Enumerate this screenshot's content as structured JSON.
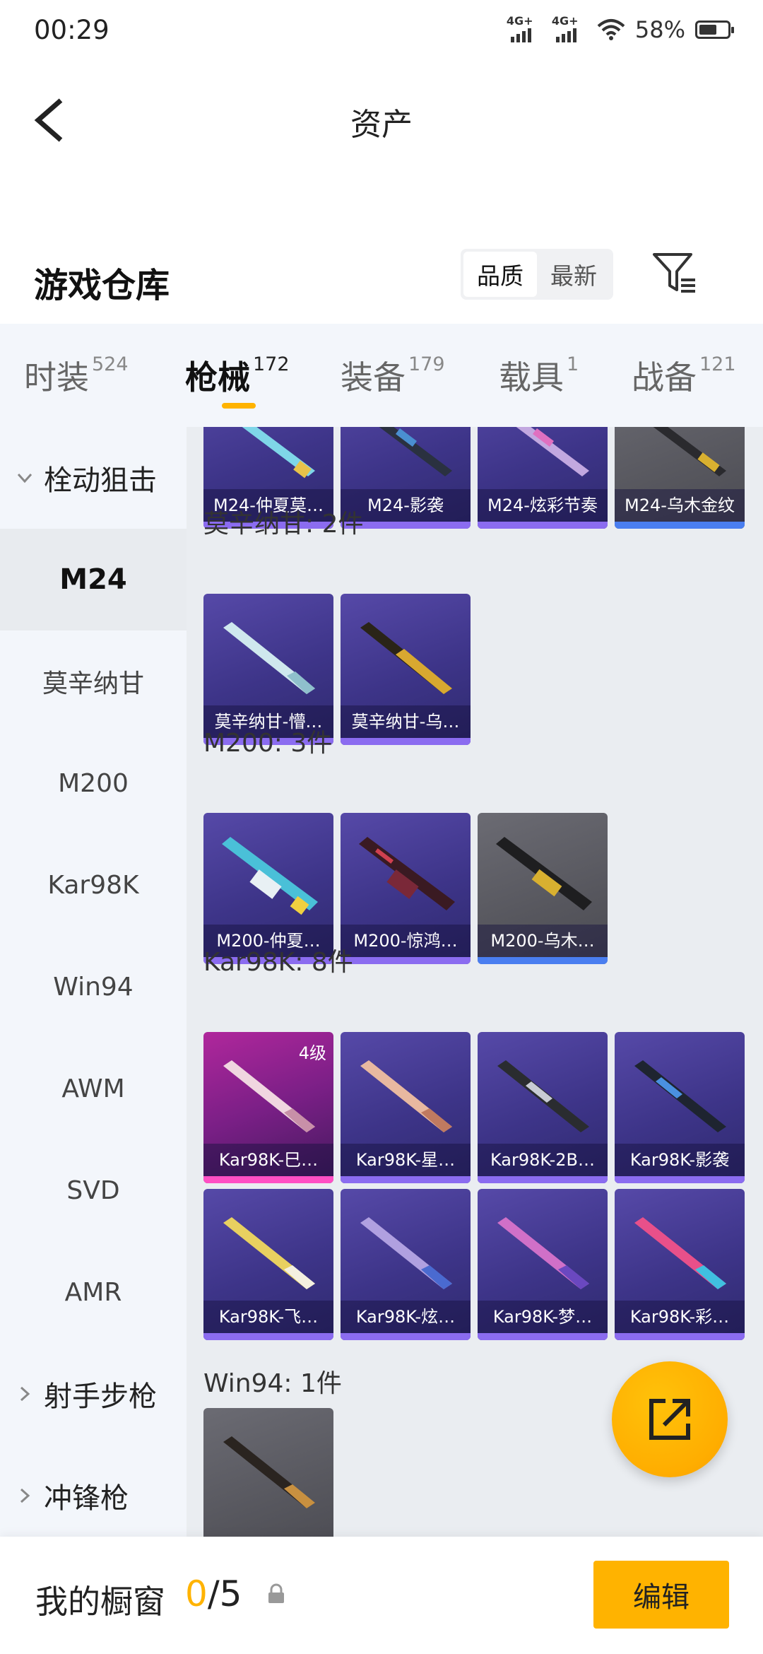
{
  "status_bar": {
    "time": "00:29",
    "sim1_label": "4G+",
    "sim2_label": "4G+",
    "battery_percent": "58%"
  },
  "nav": {
    "title": "资产"
  },
  "warehouse": {
    "title": "游戏仓库",
    "sort_options": [
      "品质",
      "最新"
    ],
    "active_sort": "品质"
  },
  "tabs": [
    {
      "label": "时装",
      "count": "524"
    },
    {
      "label": "枪械",
      "count": "172"
    },
    {
      "label": "装备",
      "count": "179"
    },
    {
      "label": "载具",
      "count": "1"
    },
    {
      "label": "战备",
      "count": "121"
    }
  ],
  "active_tab": "枪械",
  "sidebar": {
    "group_sniper": "栓动狙击",
    "items": [
      "M24",
      "莫辛纳甘",
      "M200",
      "Kar98K",
      "Win94",
      "AWM",
      "SVD",
      "AMR"
    ],
    "active_item": "M24",
    "group_marksman": "射手步枪",
    "group_smg": "冲锋枪"
  },
  "content": {
    "m24_cards": [
      "M24-仲夏莫…",
      "M24-影袭",
      "M24-炫彩节奏",
      "M24-乌木金纹"
    ],
    "mosin_title": "莫辛纳甘: 2件",
    "mosin_cards": [
      "莫辛纳甘-懵…",
      "莫辛纳甘-乌…"
    ],
    "m200_title": "M200: 3件",
    "m200_cards": [
      "M200-仲夏…",
      "M200-惊鸿…",
      "M200-乌木…"
    ],
    "kar_title": "Kar98K: 8件",
    "kar_cards": [
      "Kar98K-巳…",
      "Kar98K-星…",
      "Kar98K-2B…",
      "Kar98K-影袭",
      "Kar98K-飞…",
      "Kar98K-炫…",
      "Kar98K-梦…",
      "Kar98K-彩…"
    ],
    "kar_level_badge": "4级",
    "win94_title": "Win94: 1件"
  },
  "bottom_bar": {
    "showcase_label": "我的橱窗",
    "used": "0",
    "total": "/5",
    "edit_label": "编辑"
  },
  "colors": {
    "accent": "#ffb300",
    "card_purple": "#3d3488",
    "card_grey": "#57575e",
    "card_pink": "#b0279c"
  }
}
